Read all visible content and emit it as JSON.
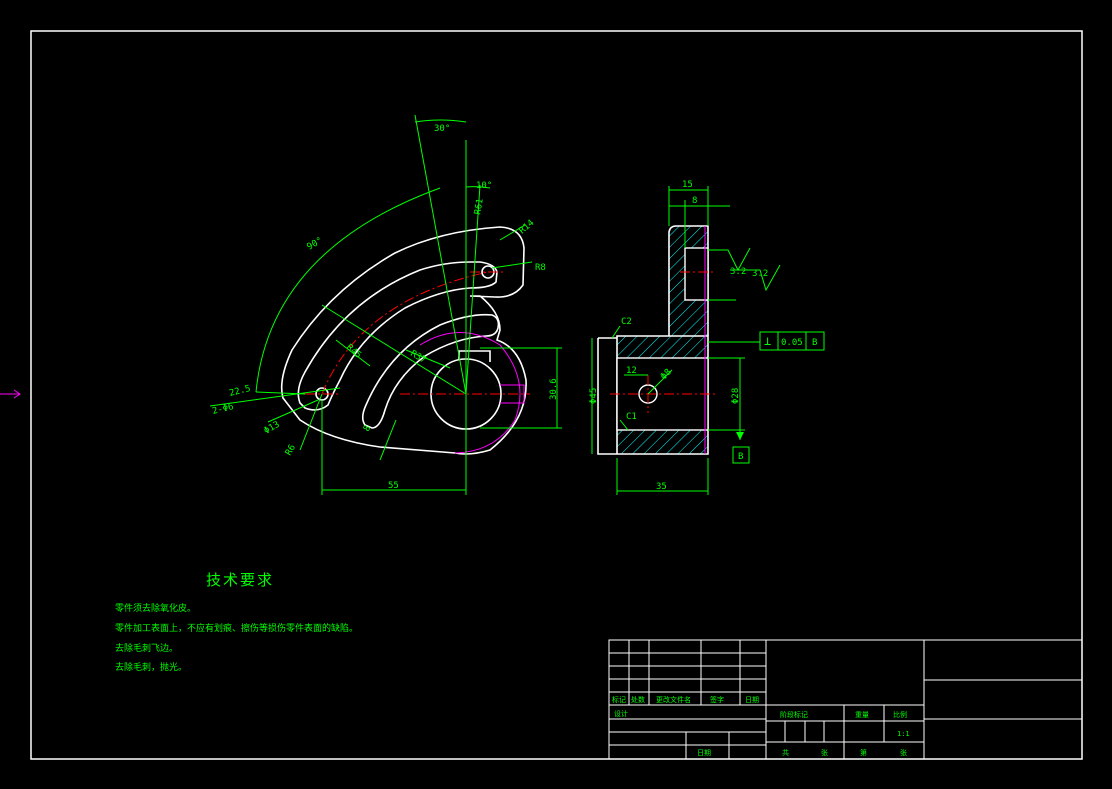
{
  "colors": {
    "background": "#000000",
    "outline": "#ffffff",
    "dimension": "#00ff00",
    "centerline": "#ff0000",
    "hatch": "#00ffff",
    "highlight": "#ff00ff"
  },
  "front_view": {
    "dims": {
      "angle_30": "30°",
      "angle_10": "10°",
      "angle_90": "90°",
      "r61": "R61",
      "r14": "R14",
      "r8": "R8",
      "dim_55": "55",
      "dim_30_6": "30.6",
      "hole_2xphi6": "2-Φ6",
      "phi13": "Φ13",
      "r6": "R6",
      "r8_lower": "R8",
      "r22_5": "22.5",
      "r45": "R45",
      "r37": "R37",
      "r8_mid": "8"
    }
  },
  "side_view": {
    "dims": {
      "dim_15": "15",
      "dim_8": "8",
      "rough_1": "3.2",
      "rough_2": "3.2",
      "c2": "C2",
      "c1": "C1",
      "dim_12": "12",
      "phi8": "Φ8",
      "phi45": "Φ45",
      "phi28": "Φ28",
      "dim_35": "35",
      "perp_symbol": "⊥",
      "perp_tol": "0.05",
      "perp_datum": "B",
      "datum_b": "B"
    }
  },
  "notes": {
    "title": "技术要求",
    "lines": [
      "零件须去除氧化皮。",
      "零件加工表面上，不应有划痕、擦伤等损伤零件表面的缺陷。",
      "去除毛刺飞边。",
      "去除毛刺，抛光。"
    ]
  },
  "title_block": {
    "headers": [
      "标记",
      "处数",
      "更改文件名",
      "签字",
      "日期"
    ],
    "designer": "设计",
    "date_label": "日期",
    "stage_mark": "阶段标记",
    "weight": "重量",
    "scale": "比例",
    "scale_value": "1:1",
    "sheet_total": "共",
    "sheet_unit": "张",
    "sheet_no": "第",
    "sheet_unit_2": "张"
  }
}
